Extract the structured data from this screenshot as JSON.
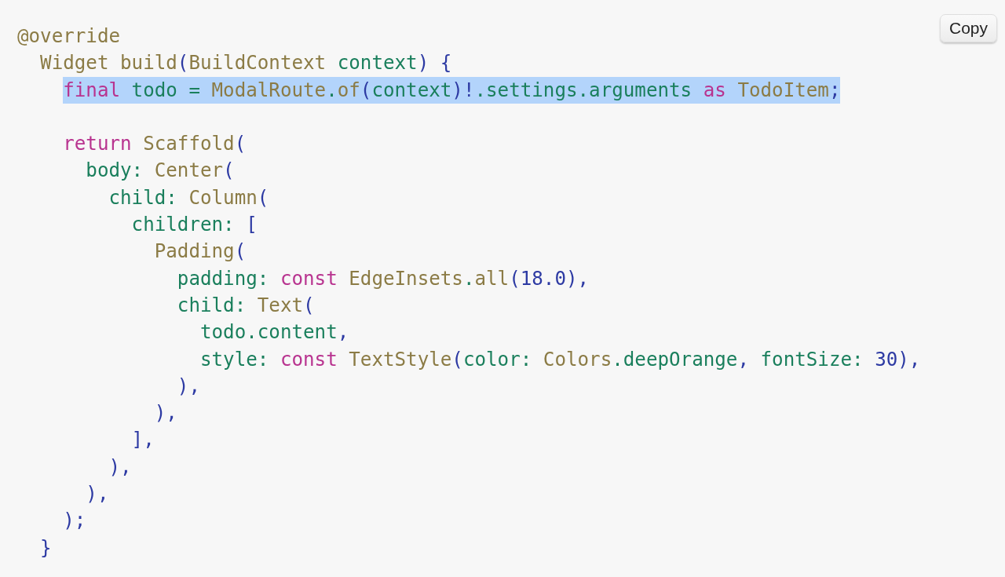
{
  "copy_button": {
    "label": "Copy"
  },
  "code_lines": [
    {
      "highlighted": false,
      "tokens": [
        {
          "text": "@override",
          "kind": "type"
        }
      ],
      "children": [
        {
          "highlighted": false,
          "tokens": [
            {
              "text": "Widget build",
              "kind": "type"
            },
            {
              "text": "(",
              "kind": "punc"
            },
            {
              "text": "BuildContext",
              "kind": "type"
            },
            {
              "text": " context",
              "kind": "id"
            },
            {
              "text": ") {",
              "kind": "punc"
            }
          ],
          "children": [
            {
              "highlighted": true,
              "tokens": [
                {
                  "text": "final",
                  "kind": "kw"
                },
                {
                  "text": " todo = ",
                  "kind": "id"
                },
                {
                  "text": "ModalRoute",
                  "kind": "type"
                },
                {
                  "text": ".",
                  "kind": "id"
                },
                {
                  "text": "of",
                  "kind": "type"
                },
                {
                  "text": "(",
                  "kind": "punc"
                },
                {
                  "text": "context",
                  "kind": "id"
                },
                {
                  "text": ")!",
                  "kind": "punc"
                },
                {
                  "text": ".settings.arguments ",
                  "kind": "id"
                },
                {
                  "text": "as",
                  "kind": "kw"
                },
                {
                  "text": " TodoItem",
                  "kind": "type"
                },
                {
                  "text": ";",
                  "kind": "punc"
                }
              ]
            },
            {
              "highlighted": false,
              "blank_before": true,
              "tokens": [
                {
                  "text": "return",
                  "kind": "kw"
                },
                {
                  "text": " Scaffold",
                  "kind": "type"
                },
                {
                  "text": "(",
                  "kind": "punc"
                }
              ],
              "children": [
                {
                  "highlighted": false,
                  "tokens": [
                    {
                      "text": "body: ",
                      "kind": "id"
                    },
                    {
                      "text": "Center",
                      "kind": "type"
                    },
                    {
                      "text": "(",
                      "kind": "punc"
                    }
                  ],
                  "children": [
                    {
                      "highlighted": false,
                      "tokens": [
                        {
                          "text": "child: ",
                          "kind": "id"
                        },
                        {
                          "text": "Column",
                          "kind": "type"
                        },
                        {
                          "text": "(",
                          "kind": "punc"
                        }
                      ],
                      "children": [
                        {
                          "highlighted": false,
                          "tokens": [
                            {
                              "text": "children: ",
                              "kind": "id"
                            },
                            {
                              "text": "[",
                              "kind": "punc"
                            }
                          ],
                          "children": [
                            {
                              "highlighted": false,
                              "tokens": [
                                {
                                  "text": "Padding",
                                  "kind": "type"
                                },
                                {
                                  "text": "(",
                                  "kind": "punc"
                                }
                              ],
                              "children": [
                                {
                                  "highlighted": false,
                                  "tokens": [
                                    {
                                      "text": "padding: ",
                                      "kind": "id"
                                    },
                                    {
                                      "text": "const",
                                      "kind": "kw"
                                    },
                                    {
                                      "text": " EdgeInsets",
                                      "kind": "type"
                                    },
                                    {
                                      "text": ".",
                                      "kind": "id"
                                    },
                                    {
                                      "text": "all",
                                      "kind": "type"
                                    },
                                    {
                                      "text": "(18.0),",
                                      "kind": "punc"
                                    }
                                  ]
                                },
                                {
                                  "highlighted": false,
                                  "tokens": [
                                    {
                                      "text": "child: ",
                                      "kind": "id"
                                    },
                                    {
                                      "text": "Text",
                                      "kind": "type"
                                    },
                                    {
                                      "text": "(",
                                      "kind": "punc"
                                    }
                                  ],
                                  "children": [
                                    {
                                      "highlighted": false,
                                      "tokens": [
                                        {
                                          "text": "todo.content",
                                          "kind": "id"
                                        },
                                        {
                                          "text": ",",
                                          "kind": "punc"
                                        }
                                      ]
                                    },
                                    {
                                      "highlighted": false,
                                      "tokens": [
                                        {
                                          "text": "style: ",
                                          "kind": "id"
                                        },
                                        {
                                          "text": "const",
                                          "kind": "kw"
                                        },
                                        {
                                          "text": " TextStyle",
                                          "kind": "type"
                                        },
                                        {
                                          "text": "(",
                                          "kind": "punc"
                                        },
                                        {
                                          "text": "color: ",
                                          "kind": "id"
                                        },
                                        {
                                          "text": "Colors",
                                          "kind": "type"
                                        },
                                        {
                                          "text": ".deepOrange",
                                          "kind": "id"
                                        },
                                        {
                                          "text": ", ",
                                          "kind": "punc"
                                        },
                                        {
                                          "text": "fontSize: ",
                                          "kind": "id"
                                        },
                                        {
                                          "text": "30),",
                                          "kind": "punc"
                                        }
                                      ]
                                    }
                                  ]
                                },
                                {
                                  "highlighted": false,
                                  "tokens": [
                                    {
                                      "text": "),",
                                      "kind": "punc"
                                    }
                                  ]
                                }
                              ]
                            },
                            {
                              "highlighted": false,
                              "tokens": [
                                {
                                  "text": "),",
                                  "kind": "punc"
                                }
                              ]
                            }
                          ]
                        },
                        {
                          "highlighted": false,
                          "tokens": [
                            {
                              "text": "],",
                              "kind": "punc"
                            }
                          ]
                        }
                      ]
                    },
                    {
                      "highlighted": false,
                      "tokens": [
                        {
                          "text": "),",
                          "kind": "punc"
                        }
                      ]
                    }
                  ]
                },
                {
                  "highlighted": false,
                  "tokens": [
                    {
                      "text": "),",
                      "kind": "punc"
                    }
                  ]
                }
              ]
            },
            {
              "highlighted": false,
              "tokens": [
                {
                  "text": ");",
                  "kind": "punc"
                }
              ]
            }
          ]
        },
        {
          "highlighted": false,
          "tokens": [
            {
              "text": "}",
              "kind": "punc"
            }
          ]
        }
      ]
    }
  ]
}
